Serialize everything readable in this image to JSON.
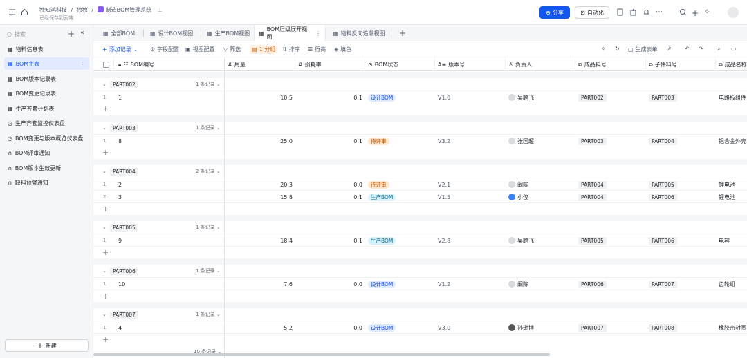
{
  "topbar": {
    "breadcrumb": [
      "独知鸿科技",
      "/",
      "独独",
      "/"
    ],
    "app_name": "制造BOM管理系统",
    "saved": "已经保存到云端",
    "share": "分享",
    "automation": "自动化"
  },
  "sidebar": {
    "search": "搜索",
    "new": "新建",
    "items": [
      {
        "label": "物料信息表",
        "icon": "table"
      },
      {
        "label": "BOM主表",
        "icon": "table"
      },
      {
        "label": "BOM版本记录表",
        "icon": "table"
      },
      {
        "label": "BOM变更记录表",
        "icon": "table"
      },
      {
        "label": "生产齐套计划表",
        "icon": "table"
      },
      {
        "label": "生产齐套监控仪表盘",
        "icon": "dashboard"
      },
      {
        "label": "BOM变更与版本概览仪表盘",
        "icon": "dashboard"
      },
      {
        "label": "BOM评审通知",
        "icon": "flow"
      },
      {
        "label": "BOM版本生效更新",
        "icon": "flow"
      },
      {
        "label": "缺料预警通知",
        "icon": "flow"
      }
    ]
  },
  "tabs": [
    "全部BOM",
    "设计BOM视图",
    "生产BOM视图",
    "BOM层级展开视图",
    "物料反向追溯视图"
  ],
  "toolbar": {
    "add": "添加记录",
    "fields": "字段配置",
    "view": "视图配置",
    "filter": "筛选",
    "group": "1 分组",
    "sort": "排序",
    "rowh": "行高",
    "color": "填色",
    "gen": "生成表单"
  },
  "columns": [
    "BOM编号",
    "用量",
    "损耗率",
    "BOM状态",
    "版本号",
    "负责人",
    "成品料号",
    "子件料号",
    "成品名称"
  ],
  "groups": [
    {
      "name": "PART002",
      "count": "1 条记录",
      "rows": [
        {
          "i": "1",
          "id": "1",
          "qty": "10.5",
          "loss": "0.1",
          "status": "设计BOM",
          "ver": "V1.0",
          "owner": "吴鹏飞",
          "fp": "PART002",
          "cp": "PART003",
          "name": "电路板组件"
        }
      ]
    },
    {
      "name": "PART003",
      "count": "1 条记录",
      "rows": [
        {
          "i": "1",
          "id": "8",
          "qty": "25.0",
          "loss": "0.1",
          "status": "待评审",
          "ver": "V3.2",
          "owner": "张国超",
          "fp": "PART003",
          "cp": "PART004",
          "name": "铝合金外壳"
        }
      ]
    },
    {
      "name": "PART004",
      "count": "2 条记录",
      "rows": [
        {
          "i": "1",
          "id": "2",
          "qty": "20.3",
          "loss": "0.0",
          "status": "待评审",
          "ver": "V2.1",
          "owner": "阚陈",
          "fp": "PART004",
          "cp": "PART005",
          "name": "锂电池"
        },
        {
          "i": "2",
          "id": "3",
          "qty": "15.8",
          "loss": "0.1",
          "status": "生产BOM",
          "ver": "V1.5",
          "owner": "小俊",
          "fp": "PART004",
          "cp": "PART006",
          "name": "锂电池"
        }
      ]
    },
    {
      "name": "PART005",
      "count": "1 条记录",
      "rows": [
        {
          "i": "1",
          "id": "9",
          "qty": "18.4",
          "loss": "0.1",
          "status": "生产BOM",
          "ver": "V2.8",
          "owner": "吴鹏飞",
          "fp": "PART005",
          "cp": "PART006",
          "name": "电容"
        }
      ]
    },
    {
      "name": "PART006",
      "count": "1 条记录",
      "rows": [
        {
          "i": "1",
          "id": "10",
          "qty": "7.6",
          "loss": "0.0",
          "status": "设计BOM",
          "ver": "V1.2",
          "owner": "阚陈",
          "fp": "PART006",
          "cp": "PART007",
          "name": "齿轮组"
        }
      ]
    },
    {
      "name": "PART007",
      "count": "1 条记录",
      "rows": [
        {
          "i": "1",
          "id": "4",
          "qty": "5.2",
          "loss": "0.0",
          "status": "设计BOM",
          "ver": "V3.0",
          "owner": "孙逊博",
          "fp": "PART007",
          "cp": "PART008",
          "name": "橡胶密封圈"
        }
      ]
    }
  ],
  "footer": "10 条记录",
  "status_colors": {
    "设计BOM": "#e1eaff",
    "待评审": "#fee7cd",
    "生产BOM": "#d9f3fd"
  }
}
